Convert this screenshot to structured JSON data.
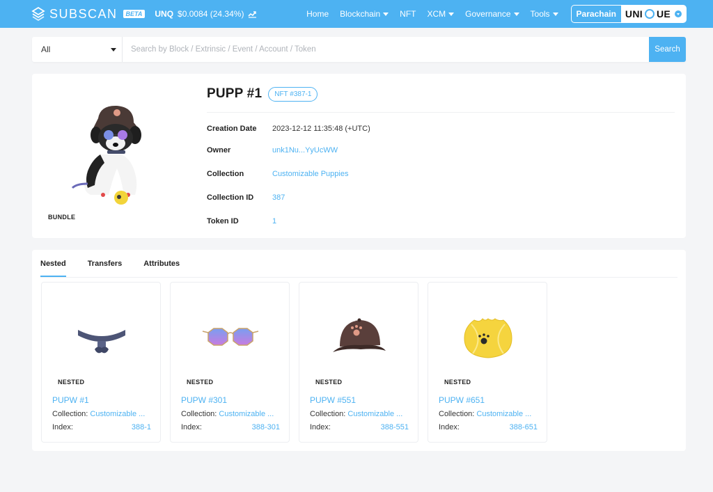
{
  "navbar": {
    "logo_text": "SUBSCAN",
    "beta": "BETA",
    "token_symbol": "UNQ",
    "token_price": "$0.0084 (24.34%)",
    "menu": [
      {
        "label": "Home",
        "dropdown": false
      },
      {
        "label": "Blockchain",
        "dropdown": true
      },
      {
        "label": "NFT",
        "dropdown": false
      },
      {
        "label": "XCM",
        "dropdown": true
      },
      {
        "label": "Governance",
        "dropdown": true
      },
      {
        "label": "Tools",
        "dropdown": true
      }
    ],
    "parachain_label": "Parachain",
    "network_name": "UNIQUE"
  },
  "search": {
    "category": "All",
    "placeholder": "Search by Block / Extrinsic / Event / Account / Token",
    "button": "Search"
  },
  "nft": {
    "title": "PUPP #1",
    "badge": "NFT #387-1",
    "type_tag": "BUNDLE",
    "fields": [
      {
        "label": "Creation Date",
        "value": "2023-12-12 11:35:48 (+UTC)",
        "link": false
      },
      {
        "label": "Owner",
        "value": "unk1Nu...YyUcWW",
        "link": true
      },
      {
        "label": "Collection",
        "value": "Customizable Puppies",
        "link": true
      },
      {
        "label": "Collection ID",
        "value": "387",
        "link": true
      },
      {
        "label": "Token ID",
        "value": "1",
        "link": true
      }
    ]
  },
  "tabs": [
    {
      "label": "Nested",
      "active": true
    },
    {
      "label": "Transfers",
      "active": false
    },
    {
      "label": "Attributes",
      "active": false
    }
  ],
  "nested_items": [
    {
      "tag": "NESTED",
      "name": "PUPW #1",
      "collection_label": "Collection:",
      "collection": "Customizable ...",
      "index_label": "Index:",
      "index": "388-1",
      "icon": "collar-icon"
    },
    {
      "tag": "NESTED",
      "name": "PUPW #301",
      "collection_label": "Collection:",
      "collection": "Customizable ...",
      "index_label": "Index:",
      "index": "388-301",
      "icon": "sunglasses-icon"
    },
    {
      "tag": "NESTED",
      "name": "PUPW #551",
      "collection_label": "Collection:",
      "collection": "Customizable ...",
      "index_label": "Index:",
      "index": "388-551",
      "icon": "cap-icon"
    },
    {
      "tag": "NESTED",
      "name": "PUPW #651",
      "collection_label": "Collection:",
      "collection": "Customizable ...",
      "index_label": "Index:",
      "index": "388-651",
      "icon": "tennis-ball-icon"
    }
  ],
  "colors": {
    "accent": "#4db2f2",
    "background": "#f4f5f7"
  }
}
